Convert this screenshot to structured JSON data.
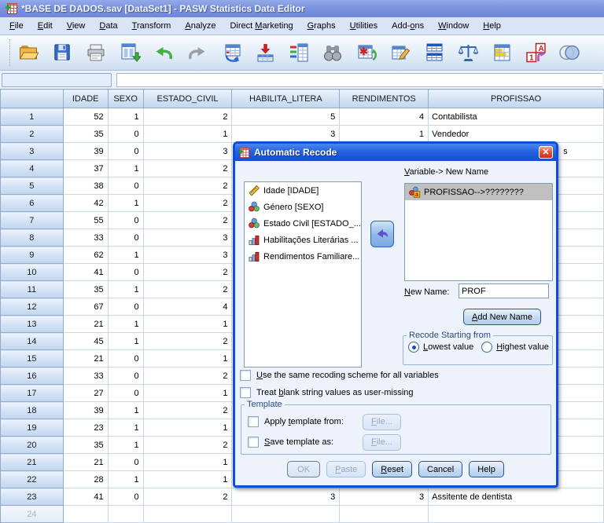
{
  "window": {
    "title": "*BASE DE DADOS.sav [DataSet1] - PASW Statistics Data Editor"
  },
  "menu": {
    "items": [
      {
        "label": "File",
        "u": 0
      },
      {
        "label": "Edit",
        "u": 0
      },
      {
        "label": "View",
        "u": 0
      },
      {
        "label": "Data",
        "u": 0
      },
      {
        "label": "Transform",
        "u": 0
      },
      {
        "label": "Analyze",
        "u": 0
      },
      {
        "label": "Direct Marketing",
        "u": 7
      },
      {
        "label": "Graphs",
        "u": 0
      },
      {
        "label": "Utilities",
        "u": 0
      },
      {
        "label": "Add-ons",
        "u": 4
      },
      {
        "label": "Window",
        "u": 0
      },
      {
        "label": "Help",
        "u": 0
      }
    ]
  },
  "toolbar": {
    "icons": [
      "open-file",
      "save-file",
      "print",
      "recall-dialogs",
      "undo",
      "redo",
      "goto-case",
      "goto-variable",
      "variables",
      "find",
      "insert-cases",
      "insert-variable",
      "split-file",
      "weight-cases",
      "select-cases",
      "value-labels",
      "use-variable-sets"
    ]
  },
  "cell_editor": {
    "reference": "",
    "value": ""
  },
  "grid": {
    "columns": [
      "",
      "IDADE",
      "SEXO",
      "ESTADO_CIVIL",
      "HABILITA_LITERA",
      "RENDIMENTOS",
      "PROFISSAO"
    ],
    "rows": [
      {
        "n": "1",
        "idade": "52",
        "sexo": "1",
        "estado_civil": "2",
        "habilita": "5",
        "rendimentos": "4",
        "profissao": "Contabilista"
      },
      {
        "n": "2",
        "idade": "35",
        "sexo": "0",
        "estado_civil": "1",
        "habilita": "3",
        "rendimentos": "1",
        "profissao": "Vendedor"
      },
      {
        "n": "3",
        "idade": "39",
        "sexo": "0",
        "estado_civil": "3",
        "habilita": "",
        "rendimentos": "",
        "profissao": "",
        "profissao_visible_fragment": "s"
      },
      {
        "n": "4",
        "idade": "37",
        "sexo": "1",
        "estado_civil": "2",
        "habilita": "",
        "rendimentos": "",
        "profissao": ""
      },
      {
        "n": "5",
        "idade": "38",
        "sexo": "0",
        "estado_civil": "2",
        "habilita": "",
        "rendimentos": "",
        "profissao": ""
      },
      {
        "n": "6",
        "idade": "42",
        "sexo": "1",
        "estado_civil": "2",
        "habilita": "",
        "rendimentos": "",
        "profissao": ""
      },
      {
        "n": "7",
        "idade": "55",
        "sexo": "0",
        "estado_civil": "2",
        "habilita": "",
        "rendimentos": "",
        "profissao": ""
      },
      {
        "n": "8",
        "idade": "33",
        "sexo": "0",
        "estado_civil": "3",
        "habilita": "",
        "rendimentos": "",
        "profissao": ""
      },
      {
        "n": "9",
        "idade": "62",
        "sexo": "1",
        "estado_civil": "3",
        "habilita": "",
        "rendimentos": "",
        "profissao": ""
      },
      {
        "n": "10",
        "idade": "41",
        "sexo": "0",
        "estado_civil": "2",
        "habilita": "",
        "rendimentos": "",
        "profissao": ""
      },
      {
        "n": "11",
        "idade": "35",
        "sexo": "1",
        "estado_civil": "2",
        "habilita": "",
        "rendimentos": "",
        "profissao": ""
      },
      {
        "n": "12",
        "idade": "67",
        "sexo": "0",
        "estado_civil": "4",
        "habilita": "",
        "rendimentos": "",
        "profissao": ""
      },
      {
        "n": "13",
        "idade": "21",
        "sexo": "1",
        "estado_civil": "1",
        "habilita": "",
        "rendimentos": "",
        "profissao": ""
      },
      {
        "n": "14",
        "idade": "45",
        "sexo": "1",
        "estado_civil": "2",
        "habilita": "",
        "rendimentos": "",
        "profissao": ""
      },
      {
        "n": "15",
        "idade": "21",
        "sexo": "0",
        "estado_civil": "1",
        "habilita": "",
        "rendimentos": "",
        "profissao": ""
      },
      {
        "n": "16",
        "idade": "33",
        "sexo": "0",
        "estado_civil": "2",
        "habilita": "",
        "rendimentos": "",
        "profissao": ""
      },
      {
        "n": "17",
        "idade": "27",
        "sexo": "0",
        "estado_civil": "1",
        "habilita": "",
        "rendimentos": "",
        "profissao": ""
      },
      {
        "n": "18",
        "idade": "39",
        "sexo": "1",
        "estado_civil": "2",
        "habilita": "",
        "rendimentos": "",
        "profissao": ""
      },
      {
        "n": "19",
        "idade": "23",
        "sexo": "1",
        "estado_civil": "1",
        "habilita": "",
        "rendimentos": "",
        "profissao": ""
      },
      {
        "n": "20",
        "idade": "35",
        "sexo": "1",
        "estado_civil": "2",
        "habilita": "",
        "rendimentos": "",
        "profissao": ""
      },
      {
        "n": "21",
        "idade": "21",
        "sexo": "0",
        "estado_civil": "1",
        "habilita": "",
        "rendimentos": "",
        "profissao": ""
      },
      {
        "n": "22",
        "idade": "28",
        "sexo": "1",
        "estado_civil": "1",
        "habilita": "",
        "rendimentos": "",
        "profissao": ""
      },
      {
        "n": "23",
        "idade": "41",
        "sexo": "0",
        "estado_civil": "2",
        "habilita": "3",
        "rendimentos": "3",
        "profissao": "Assitente de dentista"
      },
      {
        "n": "24",
        "idade": "",
        "sexo": "",
        "estado_civil": "",
        "habilita": "",
        "rendimentos": "",
        "profissao": "",
        "partial": true
      }
    ]
  },
  "dialog": {
    "title": "Automatic Recode",
    "source_variables": [
      {
        "label": "Idade [IDADE]",
        "measure": "scale"
      },
      {
        "label": "Género [SEXO]",
        "measure": "nominal"
      },
      {
        "label": "Estado Civil [ESTADO_...",
        "measure": "nominal"
      },
      {
        "label": "Habilitações Literárias ...",
        "measure": "ordinal"
      },
      {
        "label": "Rendimentos Familiare...",
        "measure": "ordinal"
      }
    ],
    "target_list_label": {
      "label": "Variable-> New Name",
      "u": 0
    },
    "target_items": [
      {
        "label": "PROFISSAO-->????????",
        "measure": "nominal-string",
        "selected": true
      }
    ],
    "new_name_label": {
      "label": "New Name:",
      "u": 0
    },
    "new_name_value": "PROF",
    "add_button": {
      "label": "Add New Name",
      "u": 0
    },
    "recode_group": {
      "legend": "Recode Starting from",
      "options": [
        {
          "label": "Lowest value",
          "u": 0,
          "selected": true
        },
        {
          "label": "Highest value",
          "u": 0,
          "selected": false
        }
      ]
    },
    "checkboxes": [
      {
        "label": "Use the same recoding scheme for all variables",
        "u": 0,
        "checked": false
      },
      {
        "label": "Treat blank string values as user-missing",
        "u": 6,
        "checked": false
      }
    ],
    "template_group": {
      "legend": "Template",
      "rows": [
        {
          "label": "Apply template from:",
          "u": 6,
          "checked": false,
          "button": {
            "label": "File...",
            "u": 0
          },
          "button_enabled": false
        },
        {
          "label": "Save template as:",
          "u": 0,
          "checked": false,
          "button": {
            "label": "File...",
            "u": 0
          },
          "button_enabled": false
        }
      ]
    },
    "buttons": [
      {
        "label": "OK",
        "enabled": false,
        "default": true
      },
      {
        "label": "Paste",
        "u": 0,
        "enabled": false
      },
      {
        "label": "Reset",
        "u": 0,
        "enabled": true
      },
      {
        "label": "Cancel",
        "enabled": true
      },
      {
        "label": "Help",
        "enabled": true
      }
    ]
  },
  "colors": {
    "titlebar_inactive": "#7b93df",
    "dialog_titlebar": "#2463de",
    "dialog_border": "#0d4fd6",
    "dialog_bg": "#edf2fb",
    "grid_header_bg": "#d2e1f4",
    "grid_line": "#c8d8ec",
    "selection_gray": "#c0c0c0",
    "close_button_red": "#e2573a"
  }
}
